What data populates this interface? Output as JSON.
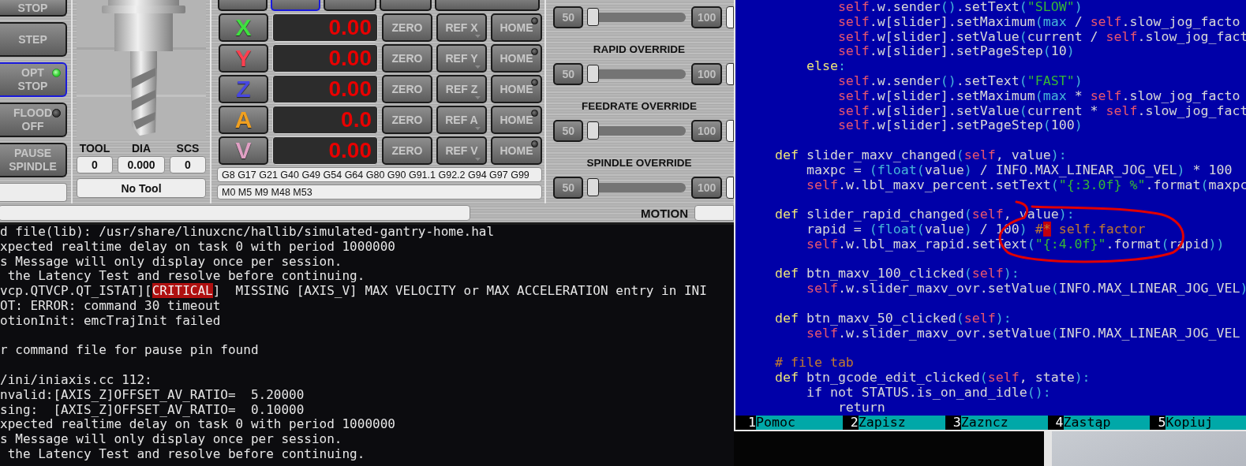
{
  "side_buttons": [
    {
      "label": "STOP",
      "kind": "plain"
    },
    {
      "label": "STEP",
      "kind": "plain"
    },
    {
      "label": "OPT STOP",
      "kind": "toggle",
      "checked": true
    },
    {
      "label": "FLOOD OFF",
      "kind": "toggle",
      "checked": false
    },
    {
      "label": "PAUSE SPINDLE",
      "kind": "plain"
    }
  ],
  "tool_info": {
    "headers": [
      "TOOL",
      "DIA",
      "SCS"
    ],
    "values": [
      "0",
      "0.000",
      "0"
    ],
    "description": "No Tool"
  },
  "mode_buttons": [
    {
      "selected": false
    },
    {
      "selected": true
    },
    {
      "selected": false
    },
    {
      "selected": false
    },
    {
      "selected": false
    }
  ],
  "axes": [
    {
      "letter": "X",
      "color": "#3fe03f",
      "value": "0.00",
      "zero": "ZERO",
      "ref": "REF X",
      "home": "HOME",
      "homed": false
    },
    {
      "letter": "Y",
      "color": "#ff4050",
      "value": "0.00",
      "zero": "ZERO",
      "ref": "REF Y",
      "home": "HOME",
      "homed": false
    },
    {
      "letter": "Z",
      "color": "#4848e0",
      "value": "0.00",
      "zero": "ZERO",
      "ref": "REF Z",
      "home": "HOME",
      "homed": false
    },
    {
      "letter": "A",
      "color": "#f0a020",
      "value": "0.0",
      "zero": "ZERO",
      "ref": "REF A",
      "home": "HOME",
      "homed": false
    },
    {
      "letter": "V",
      "color": "#e0a0c4",
      "value": "0.00",
      "zero": "ZERO",
      "ref": "REF V",
      "home": "HOME",
      "homed": false
    }
  ],
  "gcodes": "G8 G17 G21 G40 G49 G54 G64 G80 G90 G91.1 G92.2 G94 G97 G99",
  "mcodes": "M0 M5 M9 M48 M53",
  "overrides": [
    {
      "min_button": "50",
      "max_button": "100",
      "level": 0
    },
    {
      "title": "RAPID OVERRIDE",
      "min_button": "50",
      "max_button": "100",
      "level": 0
    },
    {
      "title": "FEEDRATE OVERRIDE",
      "min_button": "50",
      "max_button": "100",
      "level": 0
    },
    {
      "title": "SPINDLE OVERRIDE",
      "min_button": "50",
      "max_button": "100",
      "level": 0
    }
  ],
  "motion_label": "MOTION",
  "terminal": {
    "lines": [
      {
        "kind": "text",
        "text": "d file(lib): /usr/share/linuxcnc/hallib/simulated-gantry-home.hal"
      },
      {
        "kind": "text",
        "text": "xpected realtime delay on task 0 with period 1000000"
      },
      {
        "kind": "text",
        "text": "s Message will only display once per session."
      },
      {
        "kind": "text",
        "text": " the Latency Test and resolve before continuing."
      },
      {
        "kind": "alert",
        "before": "vcp.QTVCP.QT_ISTAT][",
        "tag": "CRITICAL",
        "after": "]  MISSING [AXIS_V] MAX VELOCITY or MAX ACCELERATION entry in INI"
      },
      {
        "kind": "text",
        "text": "OT: ERROR: command 30 timeout"
      },
      {
        "kind": "text",
        "text": "otionInit: emcTrajInit failed"
      },
      {
        "kind": "blank"
      },
      {
        "kind": "text",
        "text": "r command file for pause pin found"
      },
      {
        "kind": "blank"
      },
      {
        "kind": "text",
        "text": "/ini/iniaxis.cc 112:"
      },
      {
        "kind": "text",
        "text": "nvalid:[AXIS_Z]OFFSET_AV_RATIO=  5.20000"
      },
      {
        "kind": "text",
        "text": "sing:  [AXIS_Z]OFFSET_AV_RATIO=  0.10000"
      },
      {
        "kind": "text",
        "text": "xpected realtime delay on task 0 with period 1000000"
      },
      {
        "kind": "text",
        "text": "s Message will only display once per session."
      },
      {
        "kind": "text",
        "text": " the Latency Test and resolve before continuing."
      }
    ]
  },
  "editor": {
    "lines": [
      {
        "kind": "code",
        "segments": [
          {
            "kind": "self",
            "text": "            self"
          },
          {
            "kind": "plain",
            "text": ".w.sender"
          },
          {
            "kind": "punct",
            "text": "()"
          },
          {
            "kind": "plain",
            "text": ".setText"
          },
          {
            "kind": "punct",
            "text": "("
          },
          {
            "kind": "string",
            "text": "\"SLOW\""
          },
          {
            "kind": "punct",
            "text": ")"
          }
        ]
      },
      {
        "kind": "code",
        "segments": [
          {
            "kind": "self",
            "text": "            self"
          },
          {
            "kind": "plain",
            "text": ".w[slider].setMaximum"
          },
          {
            "kind": "punct",
            "text": "("
          },
          {
            "kind": "builtin",
            "text": "max"
          },
          {
            "kind": "plain",
            "text": " / "
          },
          {
            "kind": "self",
            "text": "self"
          },
          {
            "kind": "plain",
            "text": ".slow_jog_facto"
          }
        ]
      },
      {
        "kind": "code",
        "segments": [
          {
            "kind": "self",
            "text": "            self"
          },
          {
            "kind": "plain",
            "text": ".w[slider].setValue"
          },
          {
            "kind": "punct",
            "text": "("
          },
          {
            "kind": "plain",
            "text": "current / "
          },
          {
            "kind": "self",
            "text": "self"
          },
          {
            "kind": "plain",
            "text": ".slow_jog_fact"
          }
        ]
      },
      {
        "kind": "code",
        "segments": [
          {
            "kind": "self",
            "text": "            self"
          },
          {
            "kind": "plain",
            "text": ".w[slider].setPageStep"
          },
          {
            "kind": "punct",
            "text": "("
          },
          {
            "kind": "plain",
            "text": "10"
          },
          {
            "kind": "punct",
            "text": ")"
          }
        ]
      },
      {
        "kind": "code",
        "segments": [
          {
            "kind": "keyword",
            "text": "        else"
          },
          {
            "kind": "punct",
            "text": ":"
          }
        ]
      },
      {
        "kind": "code",
        "segments": [
          {
            "kind": "self",
            "text": "            self"
          },
          {
            "kind": "plain",
            "text": ".w.sender"
          },
          {
            "kind": "punct",
            "text": "()"
          },
          {
            "kind": "plain",
            "text": ".setText"
          },
          {
            "kind": "punct",
            "text": "("
          },
          {
            "kind": "string",
            "text": "\"FAST\""
          },
          {
            "kind": "punct",
            "text": ")"
          }
        ]
      },
      {
        "kind": "code",
        "segments": [
          {
            "kind": "self",
            "text": "            self"
          },
          {
            "kind": "plain",
            "text": ".w[slider].setMaximum"
          },
          {
            "kind": "punct",
            "text": "("
          },
          {
            "kind": "builtin",
            "text": "max"
          },
          {
            "kind": "plain",
            "text": " * "
          },
          {
            "kind": "self",
            "text": "self"
          },
          {
            "kind": "plain",
            "text": ".slow_jog_facto"
          }
        ]
      },
      {
        "kind": "code",
        "segments": [
          {
            "kind": "self",
            "text": "            self"
          },
          {
            "kind": "plain",
            "text": ".w[slider].setValue"
          },
          {
            "kind": "punct",
            "text": "("
          },
          {
            "kind": "plain",
            "text": "current * "
          },
          {
            "kind": "self",
            "text": "self"
          },
          {
            "kind": "plain",
            "text": ".slow_jog_fact"
          }
        ]
      },
      {
        "kind": "code",
        "segments": [
          {
            "kind": "self",
            "text": "            self"
          },
          {
            "kind": "plain",
            "text": ".w[slider].setPageStep"
          },
          {
            "kind": "punct",
            "text": "("
          },
          {
            "kind": "plain",
            "text": "100"
          },
          {
            "kind": "punct",
            "text": ")"
          }
        ]
      },
      {
        "kind": "blank"
      },
      {
        "kind": "code",
        "segments": [
          {
            "kind": "keyword",
            "text": "    def"
          },
          {
            "kind": "plain",
            "text": " slider_maxv_changed"
          },
          {
            "kind": "punct",
            "text": "("
          },
          {
            "kind": "self",
            "text": "self"
          },
          {
            "kind": "plain",
            "text": ", value"
          },
          {
            "kind": "punct",
            "text": "):"
          }
        ]
      },
      {
        "kind": "code",
        "segments": [
          {
            "kind": "plain",
            "text": "        maxpc = "
          },
          {
            "kind": "punct",
            "text": "("
          },
          {
            "kind": "builtin",
            "text": "float"
          },
          {
            "kind": "punct",
            "text": "("
          },
          {
            "kind": "plain",
            "text": "value"
          },
          {
            "kind": "punct",
            "text": ")"
          },
          {
            "kind": "plain",
            "text": " / INFO.MAX_LINEAR_JOG_VEL"
          },
          {
            "kind": "punct",
            "text": ")"
          },
          {
            "kind": "plain",
            "text": " * 100"
          }
        ]
      },
      {
        "kind": "code",
        "segments": [
          {
            "kind": "self",
            "text": "        self"
          },
          {
            "kind": "plain",
            "text": ".w.lbl_maxv_percent.setText"
          },
          {
            "kind": "punct",
            "text": "("
          },
          {
            "kind": "string",
            "text": "\"{:3.0f} %\""
          },
          {
            "kind": "plain",
            "text": ".format"
          },
          {
            "kind": "punct",
            "text": "("
          },
          {
            "kind": "plain",
            "text": "maxpc"
          }
        ]
      },
      {
        "kind": "blank"
      },
      {
        "kind": "code",
        "segments": [
          {
            "kind": "keyword",
            "text": "    def"
          },
          {
            "kind": "plain",
            "text": " slider_rapid_changed"
          },
          {
            "kind": "punct",
            "text": "("
          },
          {
            "kind": "self",
            "text": "self"
          },
          {
            "kind": "plain",
            "text": ", value"
          },
          {
            "kind": "punct",
            "text": "):"
          }
        ]
      },
      {
        "kind": "code",
        "segments": [
          {
            "kind": "plain",
            "text": "        rapid = "
          },
          {
            "kind": "punct",
            "text": "("
          },
          {
            "kind": "builtin",
            "text": "float"
          },
          {
            "kind": "punct",
            "text": "("
          },
          {
            "kind": "plain",
            "text": "value"
          },
          {
            "kind": "punct",
            "text": ")"
          },
          {
            "kind": "plain",
            "text": " / 100"
          },
          {
            "kind": "punct",
            "text": ")"
          },
          {
            "kind": "comment",
            "text": " #"
          },
          {
            "kind": "cursor",
            "text": "*"
          },
          {
            "kind": "comment",
            "text": " self.factor"
          }
        ]
      },
      {
        "kind": "code",
        "segments": [
          {
            "kind": "self",
            "text": "        self"
          },
          {
            "kind": "plain",
            "text": ".w.lbl_max_rapid.setText"
          },
          {
            "kind": "punct",
            "text": "("
          },
          {
            "kind": "string",
            "text": "\"{:4.0f}\""
          },
          {
            "kind": "plain",
            "text": ".format"
          },
          {
            "kind": "punct",
            "text": "("
          },
          {
            "kind": "plain",
            "text": "rapid"
          },
          {
            "kind": "punct",
            "text": "))"
          }
        ]
      },
      {
        "kind": "blank"
      },
      {
        "kind": "code",
        "segments": [
          {
            "kind": "keyword",
            "text": "    def"
          },
          {
            "kind": "plain",
            "text": " btn_maxv_100_clicked"
          },
          {
            "kind": "punct",
            "text": "("
          },
          {
            "kind": "self",
            "text": "self"
          },
          {
            "kind": "punct",
            "text": "):"
          }
        ]
      },
      {
        "kind": "code",
        "segments": [
          {
            "kind": "self",
            "text": "        self"
          },
          {
            "kind": "plain",
            "text": ".w.slider_maxv_ovr.setValue"
          },
          {
            "kind": "punct",
            "text": "("
          },
          {
            "kind": "plain",
            "text": "INFO.MAX_LINEAR_JOG_VEL"
          },
          {
            "kind": "punct",
            "text": ")"
          }
        ]
      },
      {
        "kind": "blank"
      },
      {
        "kind": "code",
        "segments": [
          {
            "kind": "keyword",
            "text": "    def"
          },
          {
            "kind": "plain",
            "text": " btn_maxv_50_clicked"
          },
          {
            "kind": "punct",
            "text": "("
          },
          {
            "kind": "self",
            "text": "self"
          },
          {
            "kind": "punct",
            "text": "):"
          }
        ]
      },
      {
        "kind": "code",
        "segments": [
          {
            "kind": "self",
            "text": "        self"
          },
          {
            "kind": "plain",
            "text": ".w.slider_maxv_ovr.setValue"
          },
          {
            "kind": "punct",
            "text": "("
          },
          {
            "kind": "plain",
            "text": "INFO.MAX_LINEAR_JOG_VEL"
          }
        ]
      },
      {
        "kind": "blank"
      },
      {
        "kind": "code",
        "segments": [
          {
            "kind": "comment",
            "text": "    # file tab"
          }
        ]
      },
      {
        "kind": "code",
        "segments": [
          {
            "kind": "keyword",
            "text": "    def"
          },
          {
            "kind": "plain",
            "text": " btn_gcode_edit_clicked"
          },
          {
            "kind": "punct",
            "text": "("
          },
          {
            "kind": "self",
            "text": "self"
          },
          {
            "kind": "plain",
            "text": ", state"
          },
          {
            "kind": "punct",
            "text": "):"
          }
        ]
      },
      {
        "kind": "code",
        "segments": [
          {
            "kind": "plain",
            "text": "        if not STATUS.is_on_and_idle"
          },
          {
            "kind": "punct",
            "text": "():"
          }
        ]
      },
      {
        "kind": "code",
        "segments": [
          {
            "kind": "plain",
            "text": "            return"
          }
        ]
      }
    ],
    "function_keys": [
      {
        "number": "1",
        "label": "Pomoc"
      },
      {
        "number": "2",
        "label": "Zapisz"
      },
      {
        "number": "3",
        "label": "Zazncz"
      },
      {
        "number": "4",
        "label": "Zastąp"
      },
      {
        "number": "5",
        "label": "Kopiuj"
      }
    ]
  }
}
